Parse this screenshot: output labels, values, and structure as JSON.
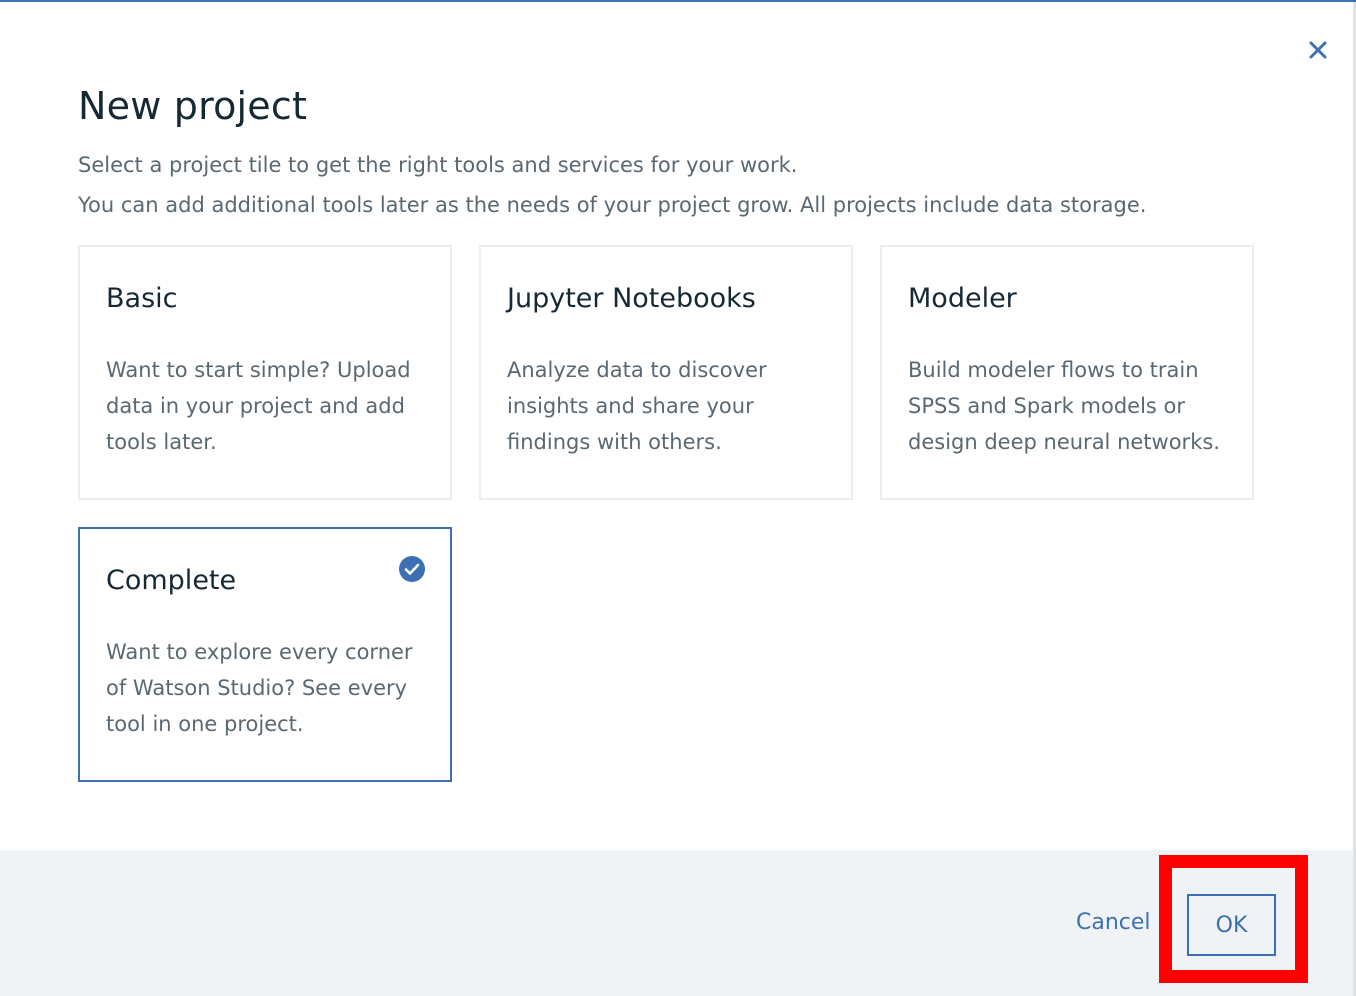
{
  "dialog": {
    "title": "New project",
    "description_line1": "Select a project tile to get the right tools and services for your work.",
    "description_line2": "You can add additional tools later as the needs of your project grow. All projects include data storage.",
    "close_icon": "close-icon"
  },
  "tiles": [
    {
      "title": "Basic",
      "description": "Want to start simple? Upload data in your project and add tools later.",
      "selected": false
    },
    {
      "title": "Jupyter Notebooks",
      "description": "Analyze data to discover insights and share your findings with others.",
      "selected": false
    },
    {
      "title": "Modeler",
      "description": "Build modeler flows to train SPSS and Spark models or design deep neural networks.",
      "selected": false
    },
    {
      "title": "Complete",
      "description": "Want to explore every corner of Watson Studio? See every tool in one project.",
      "selected": true,
      "selected_icon": "checkmark-circle-icon"
    }
  ],
  "footer": {
    "cancel_label": "Cancel",
    "ok_label": "OK"
  },
  "colors": {
    "accent": "#3d70b2",
    "title_text": "#152935",
    "body_text": "#5a6872",
    "tile_border": "#ebeef0",
    "footer_bg": "#f0f3f6",
    "annotation": "#ff0000"
  }
}
